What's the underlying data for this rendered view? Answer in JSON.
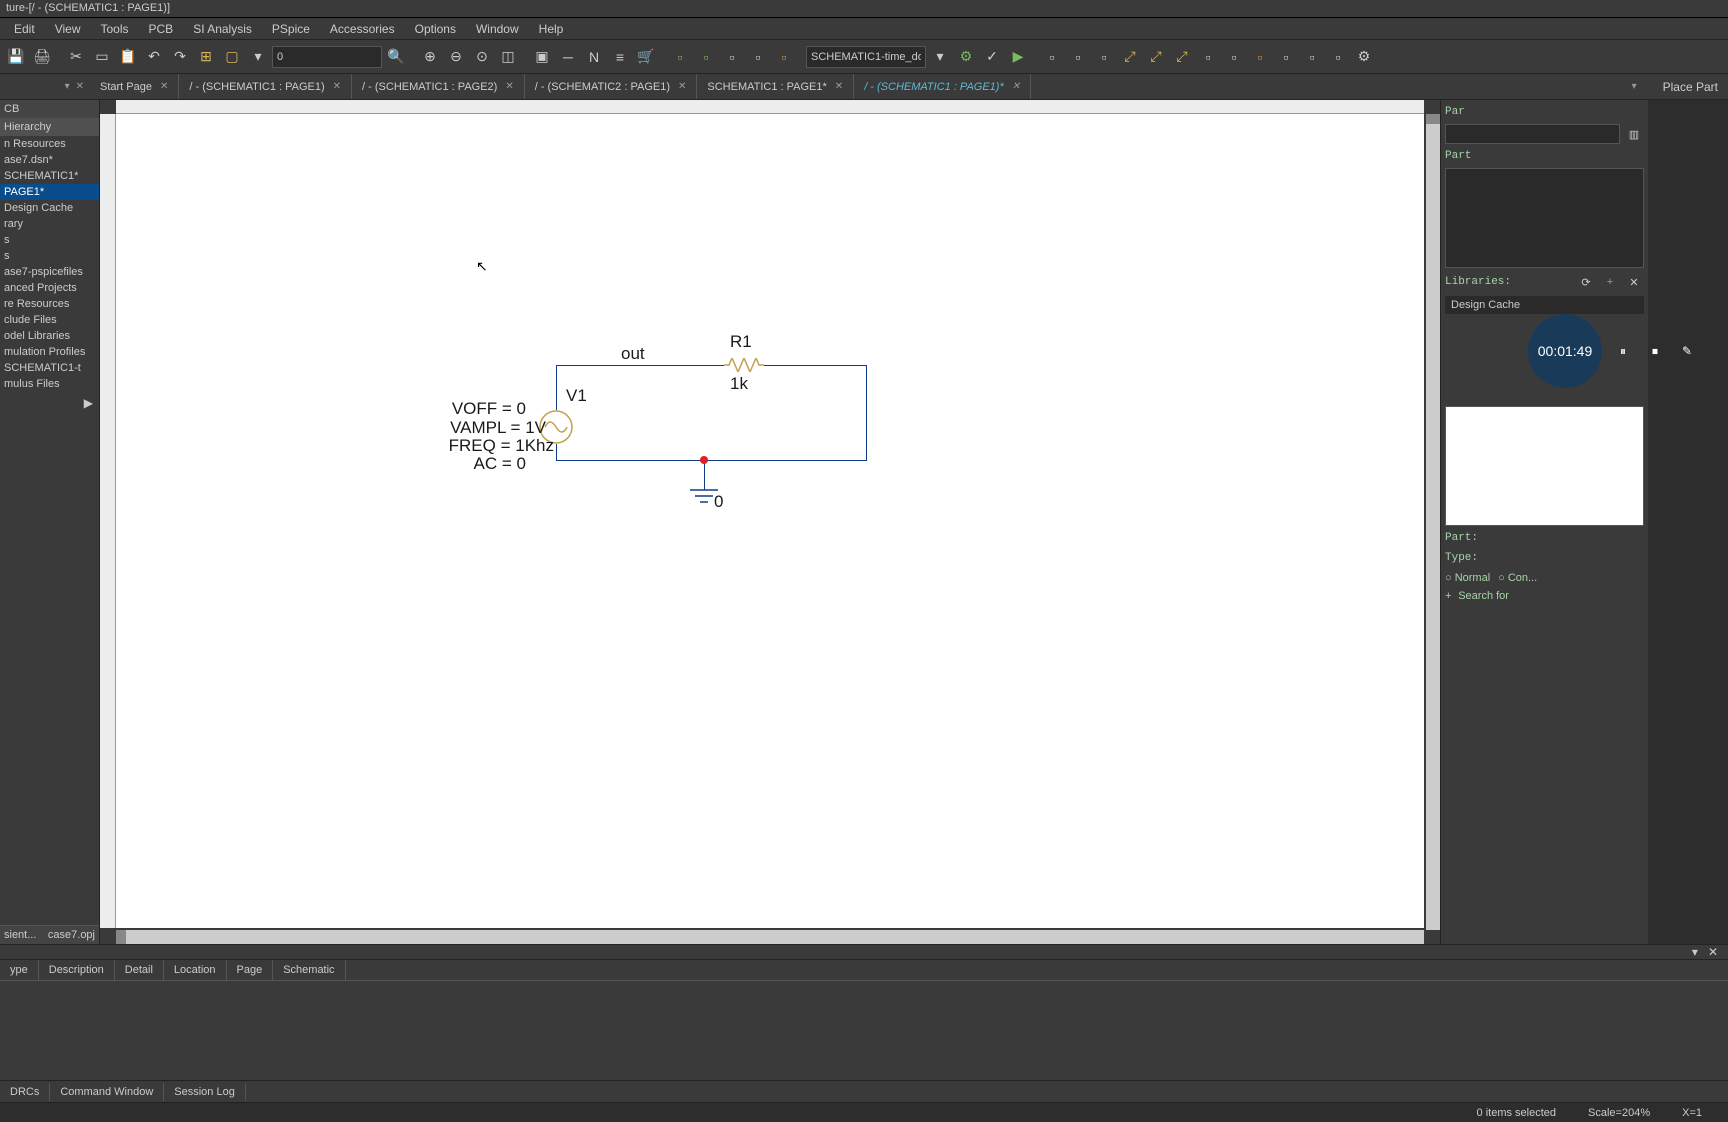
{
  "title": "ture-[/ - (SCHEMATIC1 : PAGE1)]",
  "menu": [
    "Edit",
    "View",
    "Tools",
    "PCB",
    "SI Analysis",
    "PSpice",
    "Accessories",
    "Options",
    "Window",
    "Help"
  ],
  "toolbar": {
    "dropdown_val": "0",
    "sim_profile": "SCHEMATIC1-time_do..."
  },
  "tabs": {
    "lead_ctl": [
      "▾",
      "✕"
    ],
    "items": [
      {
        "label": "Start Page",
        "active": false
      },
      {
        "label": "/ - (SCHEMATIC1 : PAGE1)",
        "active": false
      },
      {
        "label": "/ - (SCHEMATIC1 : PAGE2)",
        "active": false
      },
      {
        "label": "/ - (SCHEMATIC2 : PAGE1)",
        "active": false
      },
      {
        "label": "SCHEMATIC1 : PAGE1*",
        "active": false
      },
      {
        "label": "/ - (SCHEMATIC1 : PAGE1)*",
        "active": true
      }
    ],
    "trail_label": "Place Part"
  },
  "left_panel": {
    "head": "CB",
    "hierarchy": "Hierarchy",
    "tree": [
      "n Resources",
      "ase7.dsn*",
      "SCHEMATIC1*",
      "PAGE1*",
      "Design Cache",
      "rary",
      "s",
      "s",
      "ase7-pspicefiles",
      "anced Projects",
      "re Resources",
      "clude Files",
      "odel Libraries",
      "mulation Profiles",
      "SCHEMATIC1-t",
      "mulus Files"
    ],
    "tree_selected_idx": 3,
    "bottom_tabs": [
      "sient...",
      "case7.opj"
    ]
  },
  "schematic": {
    "net_label": "out",
    "r": {
      "name": "R1",
      "value": "1k"
    },
    "v": {
      "name": "V1",
      "voff": "VOFF = 0",
      "vampl": "VAMPL = 1V",
      "freq": "FREQ = 1Khz",
      "ac": "AC = 0"
    },
    "gnd_label": "0"
  },
  "right_panel": {
    "par_label": "Par",
    "part_label": "Part",
    "libs_label": "Libraries:",
    "lib_entry": "Design Cache",
    "part2_label": "Part:",
    "type_label": "Type:",
    "radio_normal": "Normal",
    "radio_con": "Con...",
    "search": "Search for"
  },
  "recorder": {
    "time": "00:01:49"
  },
  "detail_tabs": [
    "ype",
    "Description",
    "Detail",
    "Location",
    "Page",
    "Schematic"
  ],
  "cw_tabs": [
    "DRCs",
    "Command Window",
    "Session Log"
  ],
  "status": {
    "sel": "0 items selected",
    "scale": "Scale=204%",
    "x": "X=1"
  }
}
